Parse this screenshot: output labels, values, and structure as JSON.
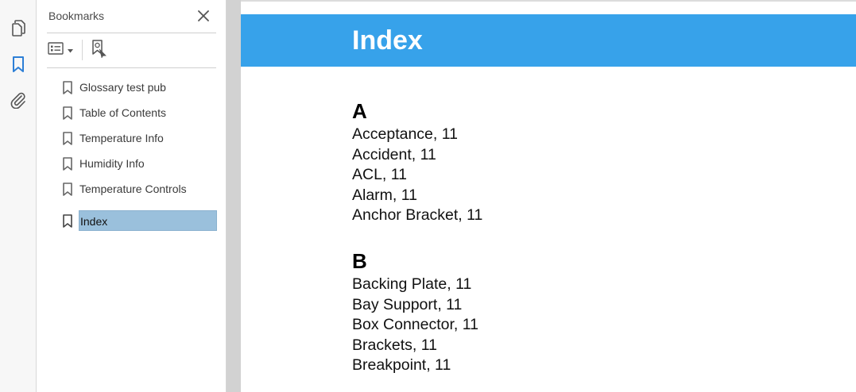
{
  "rail": {
    "items": [
      {
        "icon": "copy-pages-icon"
      },
      {
        "icon": "bookmark-icon",
        "active": true
      },
      {
        "icon": "paperclip-icon"
      }
    ]
  },
  "panel": {
    "title": "Bookmarks",
    "close_icon": "close-icon",
    "toolbar": {
      "options_icon": "list-options-icon",
      "dropdown_icon": "caret-down-icon",
      "add_bookmark_icon": "new-bookmark-icon"
    },
    "bookmarks": [
      {
        "label": "Glossary test pub"
      },
      {
        "label": "Table of Contents"
      },
      {
        "label": "Temperature Info"
      },
      {
        "label": "Humidity Info"
      },
      {
        "label": "Temperature Controls"
      },
      {
        "label": "Index",
        "selected": true
      }
    ],
    "selection_color": "#9ac0dc"
  },
  "document": {
    "header_color": "#37a2ea",
    "title": "Index",
    "sections": [
      {
        "letter": "A",
        "entries": [
          "Acceptance, 11",
          "Accident, 11",
          "ACL, 11",
          "Alarm, 11",
          "Anchor Bracket, 11"
        ]
      },
      {
        "letter": "B",
        "entries": [
          "Backing Plate, 11",
          "Bay Support, 11",
          "Box Connector, 11",
          "Brackets, 11",
          "Breakpoint, 11"
        ]
      }
    ]
  }
}
